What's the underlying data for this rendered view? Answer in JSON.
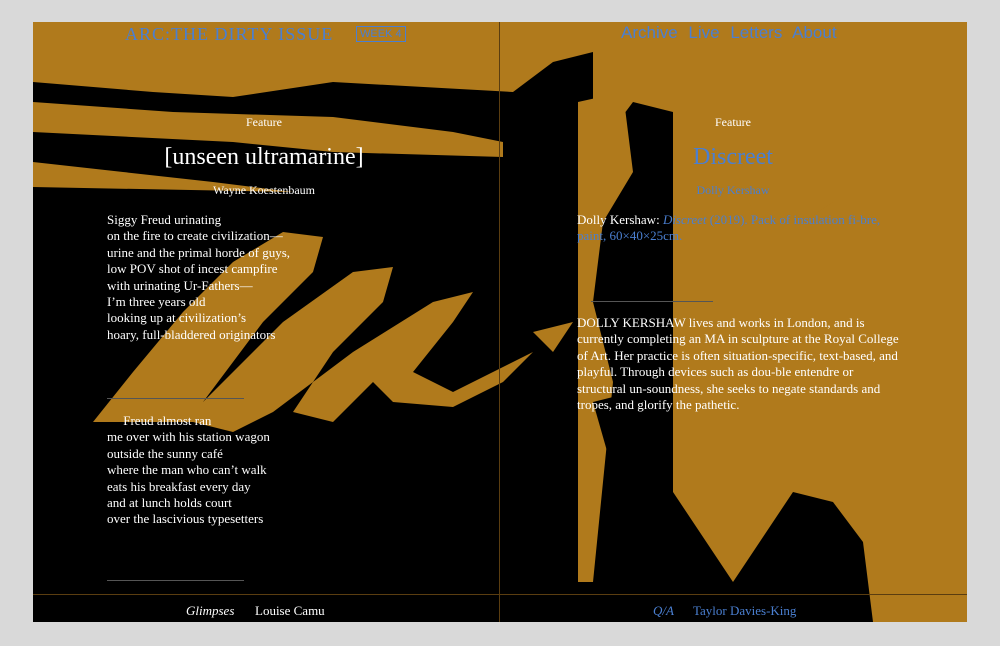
{
  "header": {
    "brand": "ARC:THE DIRTY ISSUE",
    "week": "WEEK 4",
    "nav": [
      "Archive",
      "Live",
      "Letters",
      "About"
    ]
  },
  "left": {
    "kicker": "Feature",
    "title": "[unseen ultramarine]",
    "author": "Wayne Koestenbaum",
    "poem1": "Siggy Freud urinating\non the fire to create civilization—\nurine and the primal horde of guys,\nlow POV shot of incest campfire\nwith urinating Ur-Fathers—\nI’m three years old\nlooking up at civilization’s\nhoary, full-bladdered originators",
    "poem2": "     Freud almost ran\nme over with his station wagon\noutside the sunny café\nwhere the man who can’t walk\neats his breakfast every day\nand at lunch holds court\nover the lascivious typesetters",
    "footer_series": "Glimpses",
    "footer_author": "Louise Camu"
  },
  "right": {
    "kicker": "Feature",
    "title": "Discreet",
    "author": "Dolly Kershaw",
    "caption_a": "Dolly Kershaw: ",
    "caption_b": "Discreet",
    "caption_c": " (2019). Pack of insulation fi-bre, paint, 60×40×25cm.",
    "bio": "DOLLY KERSHAW lives and works in London, and is currently completing an MA in sculpture at the Royal College of Art. Her practice is often situation-specific, text-based, and playful. Through devices such as dou-ble entendre or structural un-soundness, she seeks to negate standards and tropes, and glorify the pathetic.",
    "footer_series": "Q/A",
    "footer_author": "Taylor Davies-King"
  },
  "colors": {
    "accent": "#4a7fd1",
    "ochre": "#b07a1c",
    "background": "#000000"
  }
}
